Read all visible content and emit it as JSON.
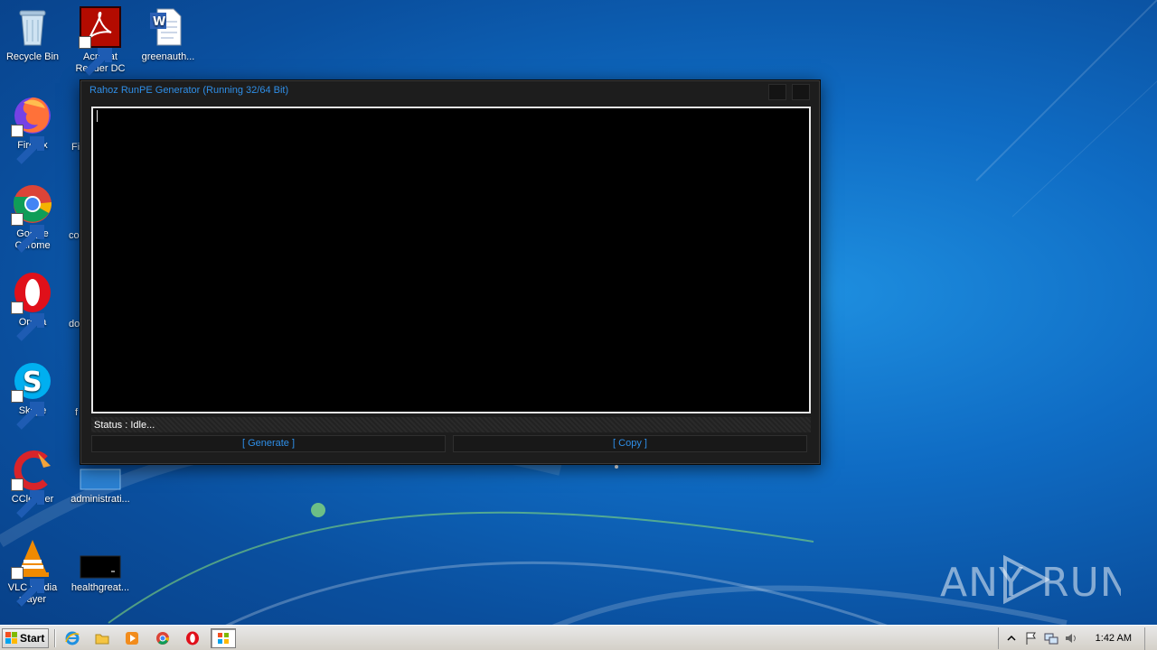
{
  "desktop": {
    "icons": [
      {
        "label": "Recycle Bin",
        "icon": "recycle-bin-icon"
      },
      {
        "label": "Acrobat Reader DC",
        "icon": "acrobat-icon"
      },
      {
        "label": "greenauth...",
        "icon": "word-document-icon"
      },
      {
        "label": "Firefox",
        "icon": "firefox-icon"
      },
      {
        "label": "Google Chrome",
        "icon": "chrome-icon"
      },
      {
        "label": "Opera",
        "icon": "opera-icon"
      },
      {
        "label": "Skype",
        "icon": "skype-icon"
      },
      {
        "label": "CCleaner",
        "icon": "ccleaner-icon"
      },
      {
        "label": "administrati...",
        "icon": "file-icon"
      },
      {
        "label": "VLC media player",
        "icon": "vlc-icon"
      },
      {
        "label": "healthgreat...",
        "icon": "black-file-icon"
      }
    ],
    "partial_labels": [
      "Fi",
      "co",
      "do",
      "f"
    ]
  },
  "app_window": {
    "title": "Rahoz RunPE Generator (Running 32/64 Bit)",
    "output_text": "",
    "status": "Status : Idle...",
    "generate_label": "[ Generate ]",
    "copy_label": "[ Copy ]"
  },
  "taskbar": {
    "start_label": "Start",
    "pinned": [
      "internet-explorer-icon",
      "folder-icon",
      "media-player-icon",
      "chrome-icon",
      "opera-icon",
      "app-window-icon"
    ],
    "clock": "1:42 AM"
  },
  "watermark": {
    "text_left": "ANY",
    "text_right": "RUN"
  },
  "colors": {
    "app_accent": "#2f8fe8",
    "app_background": "#1d1d1d",
    "desktop_blue": "#0f6cc4"
  }
}
